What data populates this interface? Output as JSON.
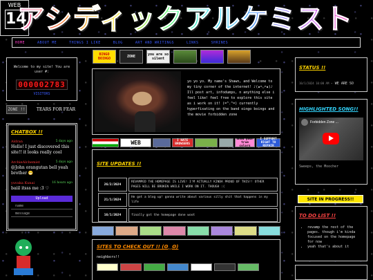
{
  "site": {
    "title": "アシディックアルケミスト"
  },
  "nav": {
    "items": [
      "HOME",
      "ABOUT ME",
      "THINGS I LIKE",
      "BLOG",
      "ART AND WRITINGS",
      "LINKS",
      "SHRINES"
    ],
    "active": "HOME"
  },
  "left": {
    "welcome_text": "Welcome to my site! You are user #:",
    "counter": "000002783",
    "visitors_label": "VISITORS",
    "button_zone": "ZONE !!",
    "button_tears": "TEARS FOR FEAR",
    "chatbox": {
      "title": "CHATBOX !!",
      "messages": [
        {
          "who": "Aldran",
          "when": "5 days ago",
          "text": "Hello! I just discovered this site!! it looks really cool"
        },
        {
          "who": "ArchieAlchemist",
          "when": "5 days ago",
          "text": "@John orangutan bell yeah brother 😁"
        },
        {
          "who": "yuvaka Kunai",
          "when": "16 hours ago",
          "text": "baiil itsss me :3 ♡"
        }
      ],
      "upload_label": "Upload",
      "name_placeholder": "name",
      "message_placeholder": "message"
    },
    "web_badge": {
      "word": "WEB",
      "number": "14"
    }
  },
  "center": {
    "badges": [
      "BINGO BOINGO",
      "ZONE",
      "you are so silent",
      "",
      "",
      ""
    ],
    "intro_text": "yo yo yo. My name's Shawn, and Welcome to my tiny corner of the internet! ♪(๑ᴖ◡ᴖ๑)♪ Ill post art, infodumps, n anything else i feel like! feel free to explore this site as i work on it! (=^.^=) currently hyperfixating on the band oingo boingo and the movie forbidden zone",
    "webbar": {
      "word": "WEB",
      "btn_hate": "I HATE BROWSERS",
      "btn_show": "Show your true colors",
      "btn_support": "I SUPPORT RIGHT TO REPAIR"
    },
    "updates": {
      "title": "SITE UPDATES !!",
      "rows": [
        {
          "date": "26/2/2024",
          "text": "REVAMPED THE HOMEPAGE IS LIVE! I'M ACTUALLY KINDA PROUD OF THIS!! OTHER PAGES WILL BE BROKEN WHILE I WORK ON IT. THOUGH :("
        },
        {
          "date": "21/1/2024",
          "text": "He got a blog up! gonna write about various silly shit that happens in my life"
        },
        {
          "date": "16/1/2024",
          "text": "finally got the homepage done woot"
        }
      ]
    },
    "sites": {
      "title": "SITES TO CHECK OUT !! (ʘ‿ʘ)",
      "neighbors_label": "neighbors!!"
    }
  },
  "right": {
    "status": {
      "title": "STATUS !!",
      "date": "10/1/2024 10:00 AM",
      "text": "- WE ARE SO"
    },
    "songs": {
      "title": "HIGHLIGHTED SONG!!",
      "video_title": "Forbidden Zone ...",
      "caption": "Sweeps, the Moocher"
    },
    "progress_label": "SITE IN PROGRESS!!",
    "todo": {
      "title": "TO DO LIST !!",
      "items": [
        "revamp the rest of the pages. though i'm kinda focused on the homepage for now",
        "yeah that's about it"
      ]
    }
  }
}
